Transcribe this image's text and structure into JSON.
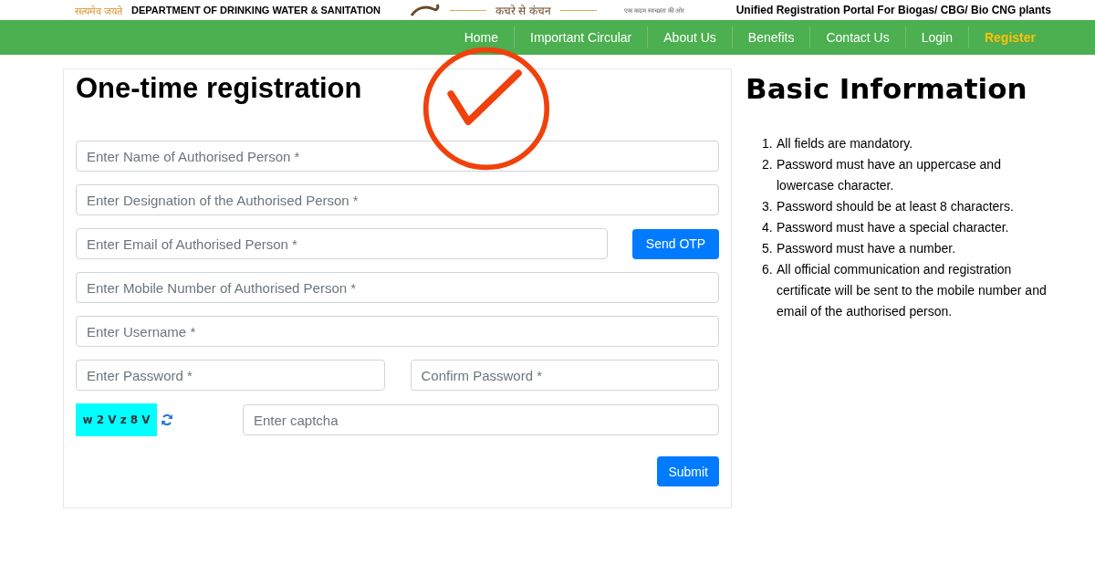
{
  "header": {
    "motto": "सत्यमेव जयते",
    "department": "DEPARTMENT OF DRINKING WATER & SANITATION",
    "slogan": "कचरे से कंचन",
    "tagline": "एक कदम स्वच्छता की ओर",
    "portal": "Unified Registration Portal For Biogas/ CBG/ Bio CNG plants"
  },
  "nav": [
    {
      "label": "Home",
      "selected": false
    },
    {
      "label": "Important Circular",
      "selected": false
    },
    {
      "label": "About Us",
      "selected": false
    },
    {
      "label": "Benefits",
      "selected": false
    },
    {
      "label": "Contact Us",
      "selected": false
    },
    {
      "label": "Login",
      "selected": false
    },
    {
      "label": "Register",
      "selected": true
    }
  ],
  "form": {
    "title": "One-time registration",
    "rows": [
      {
        "kind": "text",
        "placeholder": "Enter Name of Authorised Person *"
      },
      {
        "kind": "text",
        "placeholder": "Enter Designation of the Authorised Person *"
      },
      {
        "kind": "text_button",
        "placeholder": "Enter Email of Authorised Person *",
        "button": "Send OTP"
      },
      {
        "kind": "text",
        "placeholder": "Enter Mobile Number of Authorised Person *"
      },
      {
        "kind": "text",
        "placeholder": "Enter Username *"
      },
      {
        "kind": "pair",
        "placeholder": "Enter Password *",
        "second_placeholder": "Confirm Password *"
      },
      {
        "kind": "captcha",
        "code": "w 2 V z 8 V",
        "placeholder": "Enter captcha"
      }
    ],
    "submit": "Submit"
  },
  "info": {
    "title": "Basic Information",
    "items": [
      {
        "number": "1.",
        "text": "All fields are mandatory."
      },
      {
        "number": "2.",
        "text": "Password must have an uppercase and lowercase character."
      },
      {
        "number": "3.",
        "text": "Password should be at least 8 characters."
      },
      {
        "number": "4.",
        "text": "Password must have a special character."
      },
      {
        "number": "5.",
        "text": "Password must have a number."
      },
      {
        "number": "6.",
        "text": "All official communication and registration certificate will be sent to the mobile number and email of the authorised person."
      }
    ]
  }
}
